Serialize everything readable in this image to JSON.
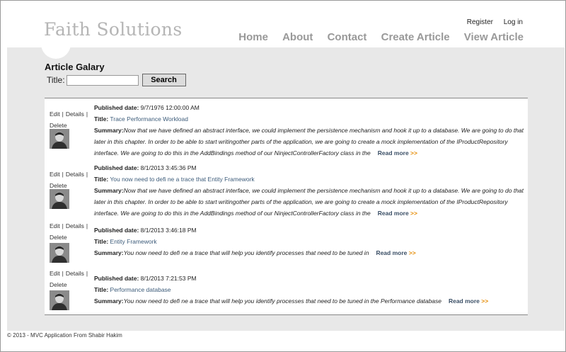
{
  "header": {
    "site_title": "Faith Solutions",
    "register": "Register",
    "login": "Log in",
    "menu": [
      "Home",
      "About",
      "Contact",
      "Create Article",
      "View Article"
    ]
  },
  "content": {
    "title": "Article Galary",
    "search_label": "Title:",
    "search_value": "",
    "search_button": "Search"
  },
  "labels": {
    "edit": "Edit",
    "details": "Details",
    "delete": "Delete",
    "sep": "|",
    "published": "Published date:",
    "title": "Title:",
    "summary": "Summary:",
    "read_more": "Read more",
    "arrows": ">>"
  },
  "articles": [
    {
      "published": "9/7/1976 12:00:00 AM",
      "title": "Trace Performance Workload",
      "summary": "Now that we have defined an abstract interface, we could implement the persistence mechanism and hook it up to a database. We are going to do that later in this chapter. In order to be able to start writingother parts of the application, we are going to create a mock implementation of the IProductRepository interface. We are going to do this in the AddBindings method of our NinjectControllerFactory class in the"
    },
    {
      "published": "8/1/2013 3:45:36 PM",
      "title": "You now need to defi ne a trace that Entity Framework",
      "summary": "Now that we have defined an abstract interface, we could implement the persistence mechanism and hook it up to a database. We are going to do that later in this chapter. In order to be able to start writingother parts of the application, we are going to create a mock implementation of the IProductRepository interface. We are going to do this in the AddBindings method of our NinjectControllerFactory class in the"
    },
    {
      "published": "8/1/2013 3:46:18 PM",
      "title": "Entity Framework",
      "summary": "You now need to defi ne a trace that will help you identify processes that need to be tuned in"
    },
    {
      "published": "8/1/2013 7:21:53 PM",
      "title": "Performance database",
      "summary": "You now need to defi ne a trace that will help you identify processes that need to be tuned in the Performance database"
    }
  ],
  "footer": "© 2013 - MVC Application From Shabir Hakim",
  "colors": {
    "accent_link": "#3d5c7a",
    "arrow": "#e58a00",
    "menu": "#999999"
  }
}
